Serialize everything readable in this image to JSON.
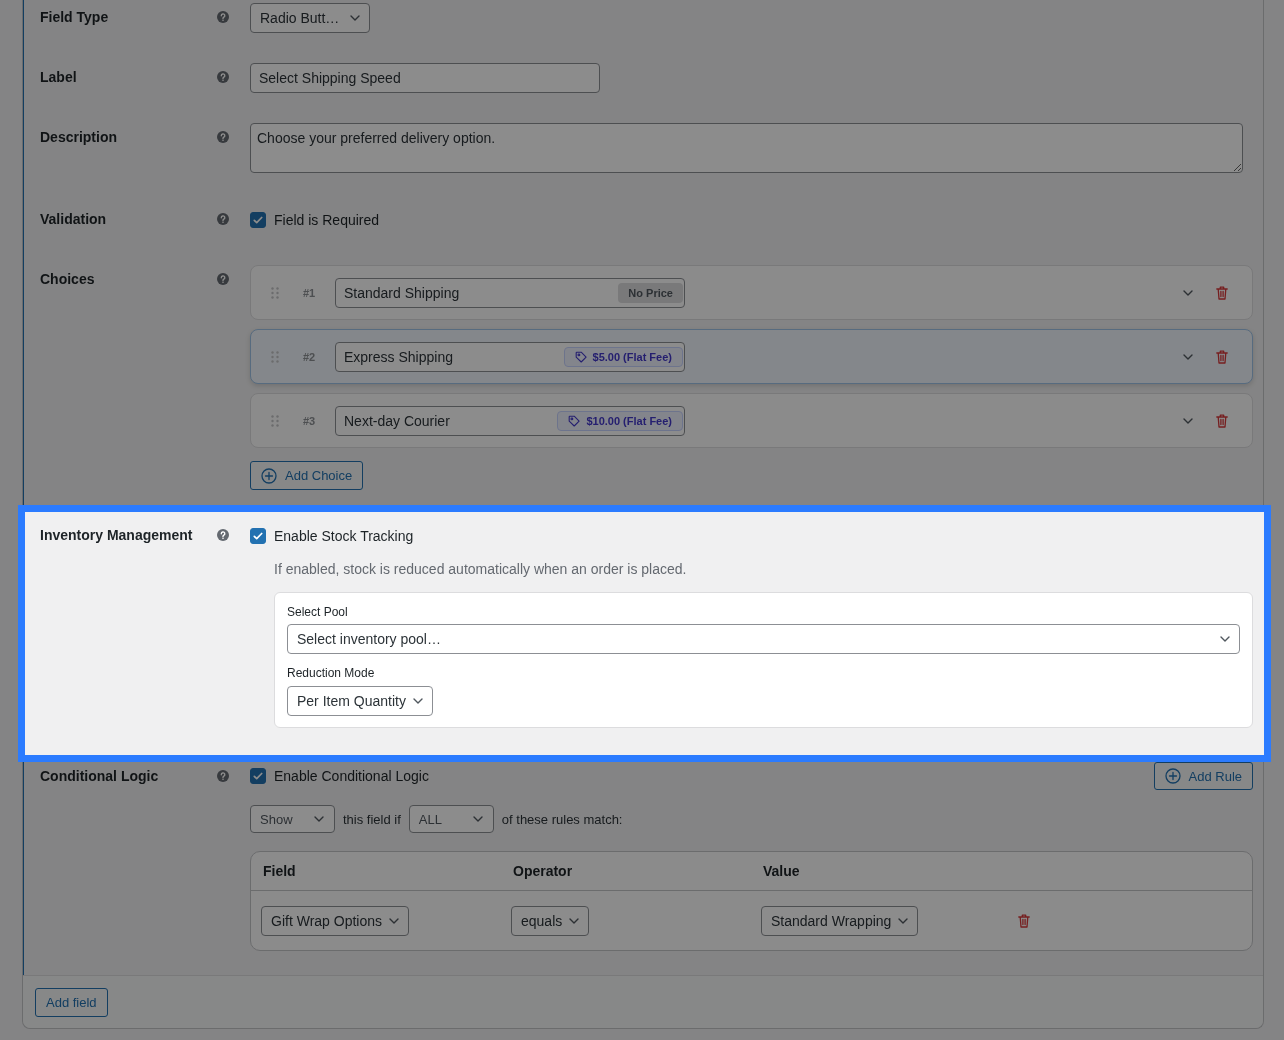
{
  "form": {
    "fields": [
      {
        "kind": "select",
        "label": "Field Type",
        "highlighted": false,
        "value": "Radio Butt…"
      },
      {
        "kind": "input",
        "label": "Label",
        "highlighted": false,
        "value": "Select Shipping Speed"
      },
      {
        "kind": "textarea",
        "label": "Description",
        "highlighted": false,
        "value": "Choose your preferred delivery option."
      },
      {
        "kind": "checkbox",
        "label": "Validation",
        "highlighted": false,
        "checkbox": {
          "label": "Field is Required",
          "checked": true
        }
      },
      {
        "kind": "choices",
        "label": "Choices",
        "highlighted": false,
        "choices": [
          {
            "number": "#1",
            "name": "Standard Shipping",
            "price": {
              "kind": "none",
              "text": "No Price"
            },
            "selected": false
          },
          {
            "number": "#2",
            "name": "Express Shipping",
            "price": {
              "kind": "flat",
              "text": "$5.00 (Flat Fee)"
            },
            "selected": true
          },
          {
            "number": "#3",
            "name": "Next-day Courier",
            "price": {
              "kind": "flat",
              "text": "$10.00 (Flat Fee)"
            },
            "selected": false
          }
        ],
        "add_button": "Add Choice"
      },
      {
        "kind": "inventory",
        "label": "Inventory Management",
        "highlighted": true,
        "checkbox": {
          "label": "Enable Stock Tracking",
          "checked": true
        },
        "hint": "If enabled, stock is reduced automatically when an order is placed.",
        "pool": {
          "label": "Select Pool",
          "value": "Select inventory pool…"
        },
        "mode": {
          "label": "Reduction Mode",
          "value": "Per Item Quantity"
        }
      },
      {
        "kind": "conditional",
        "label": "Conditional Logic",
        "highlighted": false,
        "checkbox": {
          "label": "Enable Conditional Logic",
          "checked": true
        },
        "add_button": "Add Rule",
        "action": "Show",
        "connector": "this field if",
        "match": "ALL",
        "suffix": "of these rules match:",
        "rules": {
          "columns": [
            "Field",
            "Operator",
            "Value"
          ],
          "rows": [
            {
              "field": "Gift Wrap Options",
              "operator": "equals",
              "value": "Standard Wrapping"
            }
          ]
        }
      }
    ],
    "add_field_button": "Add field"
  }
}
